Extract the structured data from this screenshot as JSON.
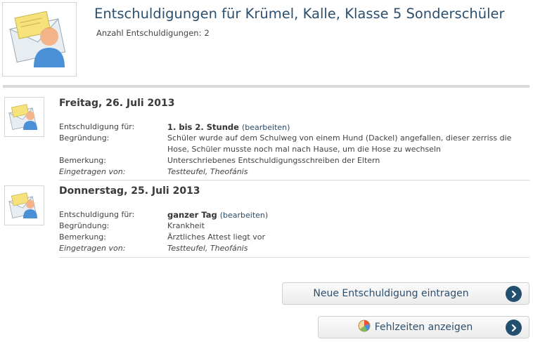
{
  "header": {
    "title": "Entschuldigungen für Krümel, Kalle, Klasse 5 Sonderschüler",
    "count_label": "Anzahl Entschuldigungen:",
    "count_value": "2"
  },
  "entries": [
    {
      "date": "Freitag, 26. Juli 2013",
      "for_label": "Entschuldigung für:",
      "for_value": "1. bis 2. Stunde",
      "edit_link": "(bearbeiten)",
      "reason_label": "Begründung:",
      "reason_value": "Schüler wurde auf dem Schulweg von einem Hund (Dackel) angefallen, dieser zerriss die Hose, Schüler musste noch mal nach Hause, um die Hose zu wechseln",
      "remark_label": "Bemerkung:",
      "remark_value": "Unterschriebenes Entschuldigungsschreiben der Eltern",
      "entered_label": "Eingetragen von:",
      "entered_value": "Testteufel, Theofánis"
    },
    {
      "date": "Donnerstag, 25. Juli 2013",
      "for_label": "Entschuldigung für:",
      "for_value": "ganzer Tag",
      "edit_link": "(bearbeiten)",
      "reason_label": "Begründung:",
      "reason_value": "Krankheit",
      "remark_label": "Bemerkung:",
      "remark_value": "Ärztliches Attest liegt vor",
      "entered_label": "Eingetragen von:",
      "entered_value": "Testteufel, Theofánis"
    }
  ],
  "actions": {
    "new_excuse": "Neue Entschuldigung eintragen",
    "show_absences": "Fehlzeiten anzeigen"
  },
  "colors": {
    "title": "#2d4f6e",
    "button_arrow": "#24506f",
    "divider": "#d9d9d9"
  }
}
